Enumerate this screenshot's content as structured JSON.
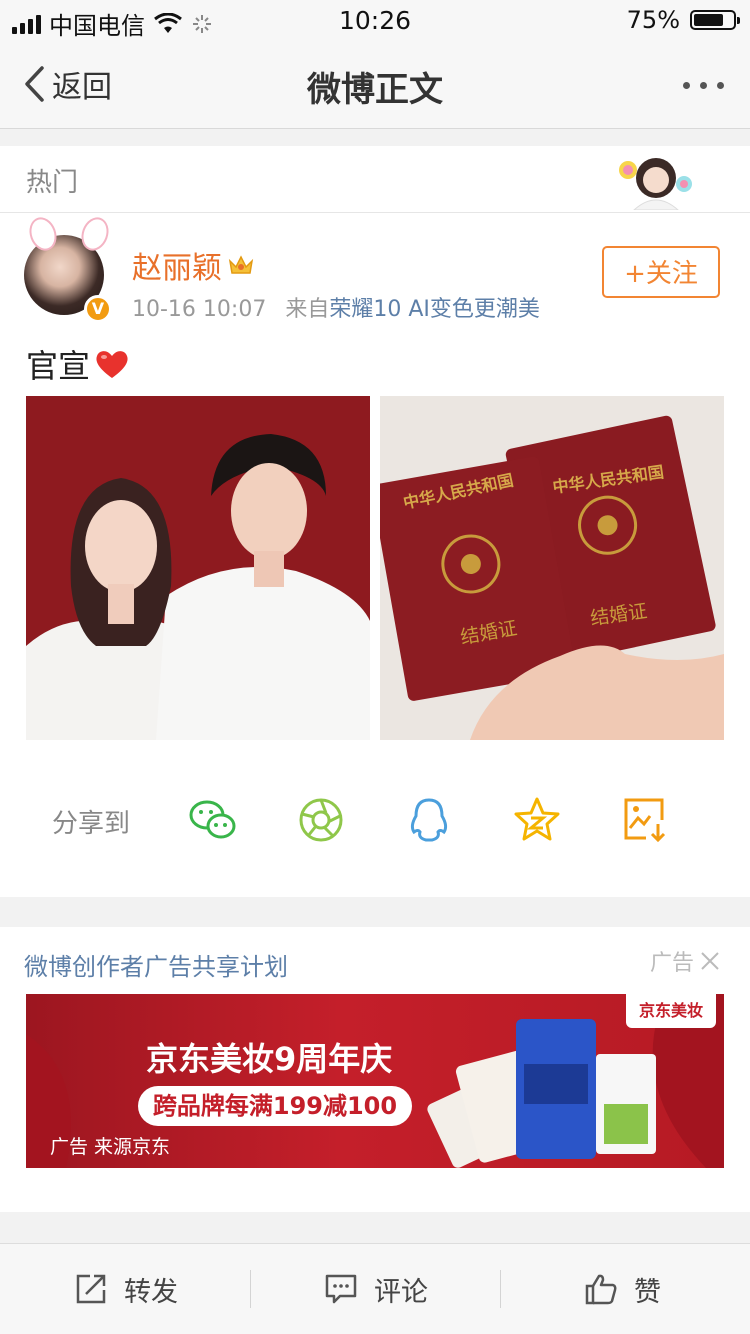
{
  "status_bar": {
    "carrier": "中国电信",
    "time": "10:26",
    "battery": "75%",
    "battery_level": 0.75
  },
  "nav": {
    "back_label": "返回",
    "title": "微博正文"
  },
  "hot_label": "热门",
  "post": {
    "username": "赵丽颖",
    "verified_badge": "V",
    "time": "10-16 10:07",
    "from_prefix": "来自",
    "source": "荣耀10 AI变色更潮美",
    "follow_label": "+关注",
    "text": "官宣",
    "emoji": "heart-emoji",
    "images": [
      {
        "alt": "wedding-photo",
        "icon": "couple-photo"
      },
      {
        "alt": "marriage-certificates",
        "cert_text_1": "中华人民共和国",
        "cert_text_2": "中华人民共和国",
        "cert_title_1": "结婚证",
        "cert_title_2": "结婚证"
      }
    ]
  },
  "share": {
    "label": "分享到",
    "targets": [
      {
        "name": "wechat",
        "color": "#39b54a"
      },
      {
        "name": "moments",
        "color": "#8fc74a"
      },
      {
        "name": "qq",
        "color": "#4b9fdc"
      },
      {
        "name": "qzone",
        "color": "#f5b400"
      },
      {
        "name": "save-image",
        "color": "#f29b11"
      }
    ]
  },
  "ad": {
    "title": "微博创作者广告共享计划",
    "tag": "广告",
    "banner_headline": "京东美妆9周年庆",
    "banner_offer": "跨品牌每满199减100",
    "banner_source": "广告 来源京东",
    "banner_brand": "京东美妆"
  },
  "toolbar": {
    "repost": "转发",
    "comment": "评论",
    "like": "赞"
  },
  "colors": {
    "accent_orange": "#f28533",
    "link_blue": "#5d7fa8",
    "username_orange": "#e8702a"
  }
}
